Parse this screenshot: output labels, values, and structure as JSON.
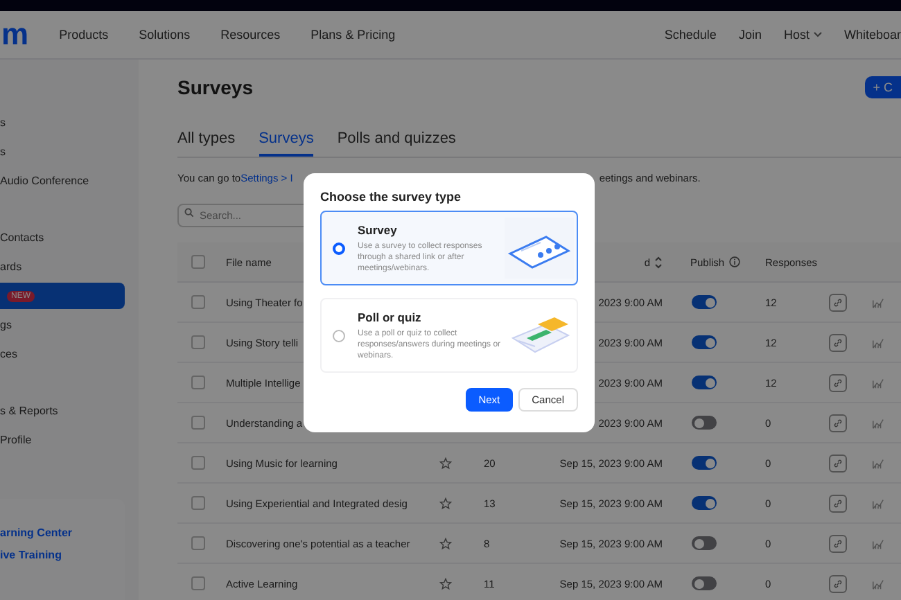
{
  "nav": {
    "logo": "m",
    "links": [
      "Products",
      "Solutions",
      "Resources",
      "Plans & Pricing"
    ],
    "right_links": [
      {
        "label": "Schedule",
        "dropdown": false
      },
      {
        "label": "Join",
        "dropdown": false
      },
      {
        "label": "Host",
        "dropdown": true
      },
      {
        "label": "Whiteboar",
        "dropdown": false
      }
    ]
  },
  "sidebar": {
    "groups": [
      [
        {
          "label": "s",
          "selected": false
        },
        {
          "label": "s",
          "selected": false
        },
        {
          "label": "Audio Conference",
          "selected": false
        }
      ],
      [
        {
          "label": "Contacts",
          "selected": false
        },
        {
          "label": "ards",
          "selected": false
        },
        {
          "badge": "NEW",
          "selected": true
        },
        {
          "label": "gs",
          "selected": false
        },
        {
          "label": "ces",
          "selected": false
        }
      ],
      [
        {
          "label": "s & Reports",
          "selected": false
        },
        {
          "label": "Profile",
          "selected": false
        }
      ]
    ],
    "card_links": [
      "arning Center",
      "ive Training"
    ]
  },
  "page": {
    "title": "Surveys",
    "new_button": "+ C",
    "tabs": [
      {
        "label": "All types",
        "selected": false
      },
      {
        "label": "Surveys",
        "selected": true
      },
      {
        "label": "Polls and quizzes",
        "selected": false
      }
    ],
    "info": {
      "before": "You can go to ",
      "link": "Settings > I",
      "after": "eetings and webinars."
    },
    "search": {
      "placeholder": "Search..."
    }
  },
  "table": {
    "columns": [
      "File name",
      "d",
      "Publish",
      "Responses"
    ],
    "all_checked": false,
    "rows": [
      {
        "checked": false,
        "name": "Using Theater fo",
        "date": "2023 9:00 AM",
        "published": true,
        "responses": "12"
      },
      {
        "checked": false,
        "name": "Using Story telli",
        "date": "2023 9:00 AM",
        "published": true,
        "responses": "12"
      },
      {
        "checked": false,
        "name": "Multiple Intellige",
        "date": "2023 9:00 AM",
        "published": true,
        "responses": "12"
      },
      {
        "checked": false,
        "name": "Understanding a",
        "date": "2023 9:00 AM",
        "published": false,
        "responses": "0"
      },
      {
        "checked": false,
        "name": "Using Music for learning",
        "count": "20",
        "date": "Sep 15, 2023 9:00 AM",
        "published": true,
        "responses": "0"
      },
      {
        "checked": false,
        "name": "Using Experiential and Integrated desig",
        "count": "13",
        "date": "Sep 15, 2023 9:00 AM",
        "published": true,
        "responses": "0"
      },
      {
        "checked": false,
        "name": "Discovering one's potential as a teacher",
        "count": "8",
        "date": "Sep 15, 2023 9:00 AM",
        "published": false,
        "responses": "0"
      },
      {
        "checked": false,
        "name": "Active Learning",
        "count": "11",
        "date": "Sep 15, 2023 9:00 AM",
        "published": false,
        "responses": "0"
      }
    ]
  },
  "dialog": {
    "title": "Choose the survey type",
    "options": [
      {
        "kind": "survey",
        "title": "Survey",
        "description": "Use a survey to collect responses through a shared link or after meetings/webinars.",
        "selected": true
      },
      {
        "kind": "poll",
        "title": "Poll or quiz",
        "description": "Use a poll or quiz to collect responses/answers during meetings or webinars.",
        "selected": false
      }
    ],
    "buttons": [
      {
        "label": "Next",
        "primary": true
      },
      {
        "label": "Cancel",
        "primary": false
      }
    ]
  }
}
